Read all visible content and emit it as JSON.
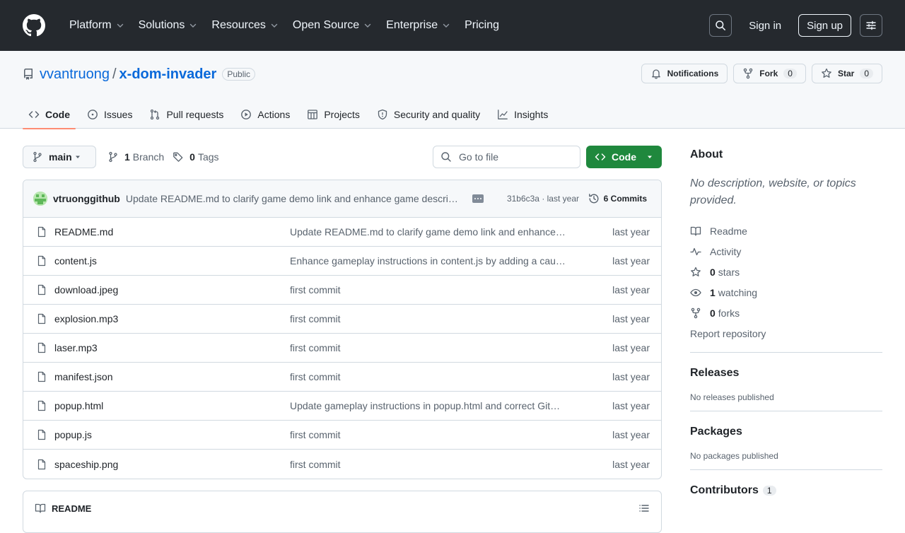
{
  "header": {
    "nav": [
      "Platform",
      "Solutions",
      "Resources",
      "Open Source",
      "Enterprise",
      "Pricing"
    ],
    "nav_has_menu": [
      true,
      true,
      true,
      true,
      true,
      false
    ],
    "sign_in": "Sign in",
    "sign_up": "Sign up"
  },
  "repo": {
    "owner": "vvantruong",
    "separator": "/",
    "name": "x-dom-invader",
    "visibility": "Public",
    "notifications_label": "Notifications",
    "fork_label": "Fork",
    "fork_count": "0",
    "star_label": "Star",
    "star_count": "0"
  },
  "tabs": [
    {
      "label": "Code",
      "icon": "code-icon",
      "active": true
    },
    {
      "label": "Issues",
      "icon": "issue-icon"
    },
    {
      "label": "Pull requests",
      "icon": "pull-request-icon"
    },
    {
      "label": "Actions",
      "icon": "play-icon"
    },
    {
      "label": "Projects",
      "icon": "table-icon"
    },
    {
      "label": "Security and quality",
      "icon": "shield-icon"
    },
    {
      "label": "Insights",
      "icon": "graph-icon"
    }
  ],
  "toolbar": {
    "branch": "main",
    "branches_count": "1",
    "branches_label": "Branch",
    "tags_count": "0",
    "tags_label": "Tags",
    "go_to_file_placeholder": "Go to file",
    "code_button": "Code"
  },
  "latest_commit": {
    "author": "vtruonggithub",
    "message": "Update README.md to clarify game demo link and enhance game description",
    "hash_and_time": "31b6c3a · last year",
    "commits_label": "6 Commits"
  },
  "files": [
    {
      "name": "README.md",
      "message": "Update README.md to clarify game demo link and enhance game description",
      "age": "last year"
    },
    {
      "name": "content.js",
      "message": "Enhance gameplay instructions in content.js by adding a caution note",
      "age": "last year"
    },
    {
      "name": "download.jpeg",
      "message": "first commit",
      "age": "last year"
    },
    {
      "name": "explosion.mp3",
      "message": "first commit",
      "age": "last year"
    },
    {
      "name": "laser.mp3",
      "message": "first commit",
      "age": "last year"
    },
    {
      "name": "manifest.json",
      "message": "first commit",
      "age": "last year"
    },
    {
      "name": "popup.html",
      "message": "Update gameplay instructions in popup.html and correct GitHub link",
      "age": "last year"
    },
    {
      "name": "popup.js",
      "message": "first commit",
      "age": "last year"
    },
    {
      "name": "spaceship.png",
      "message": "first commit",
      "age": "last year"
    }
  ],
  "readme_label": "README",
  "sidebar": {
    "about_title": "About",
    "about_desc": "No description, website, or topics provided.",
    "links": [
      {
        "icon": "book-icon",
        "strong": "",
        "text": "Readme"
      },
      {
        "icon": "pulse-icon",
        "strong": "",
        "text": "Activity"
      },
      {
        "icon": "star-icon",
        "strong": "0",
        "text": "stars"
      },
      {
        "icon": "eye-icon",
        "strong": "1",
        "text": "watching"
      },
      {
        "icon": "fork-icon",
        "strong": "0",
        "text": "forks"
      }
    ],
    "report": "Report repository",
    "releases_title": "Releases",
    "releases_sub": "No releases published",
    "packages_title": "Packages",
    "packages_sub": "No packages published",
    "contributors_title": "Contributors",
    "contributors_count": "1"
  }
}
